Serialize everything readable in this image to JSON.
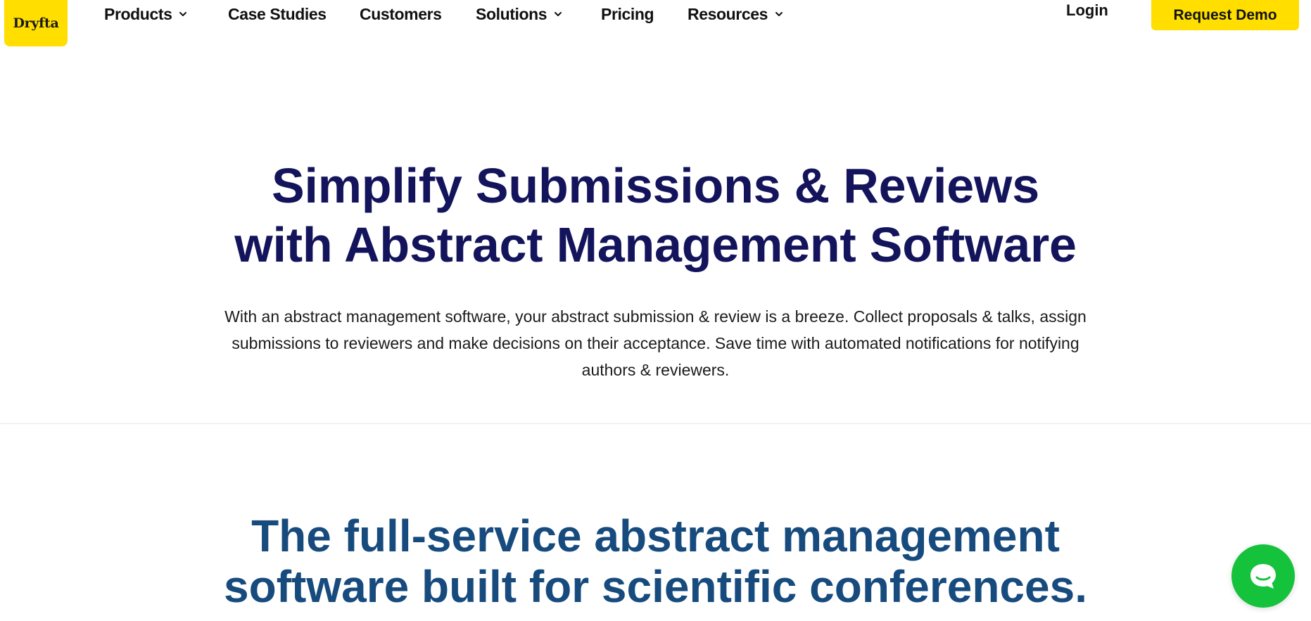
{
  "brand": {
    "logo_text": "Dryfta",
    "accent_color": "#ffde00",
    "heading_color": "#14145c",
    "section_heading_color": "#174b7e",
    "chat_color": "#14c23c"
  },
  "nav": {
    "items": [
      {
        "label": "Products",
        "has_dropdown": true
      },
      {
        "label": "Case Studies",
        "has_dropdown": false
      },
      {
        "label": "Customers",
        "has_dropdown": false
      },
      {
        "label": "Solutions",
        "has_dropdown": true
      },
      {
        "label": "Pricing",
        "has_dropdown": false
      },
      {
        "label": "Resources",
        "has_dropdown": true
      }
    ],
    "login_label": "Login",
    "cta_label": "Request Demo"
  },
  "hero": {
    "title_line1": "Simplify Submissions & Reviews",
    "title_line2": "with Abstract Management Software",
    "description": "With an abstract management software, your abstract submission & review is a breeze. Collect proposals & talks, assign submissions to reviewers and make decisions on their acceptance. Save time with automated notifications for notifying authors & reviewers."
  },
  "section": {
    "title_line1": "The full-service abstract management",
    "title_line2": "software built for scientific conferences."
  },
  "chat": {
    "icon": "chat-bubble-icon"
  }
}
